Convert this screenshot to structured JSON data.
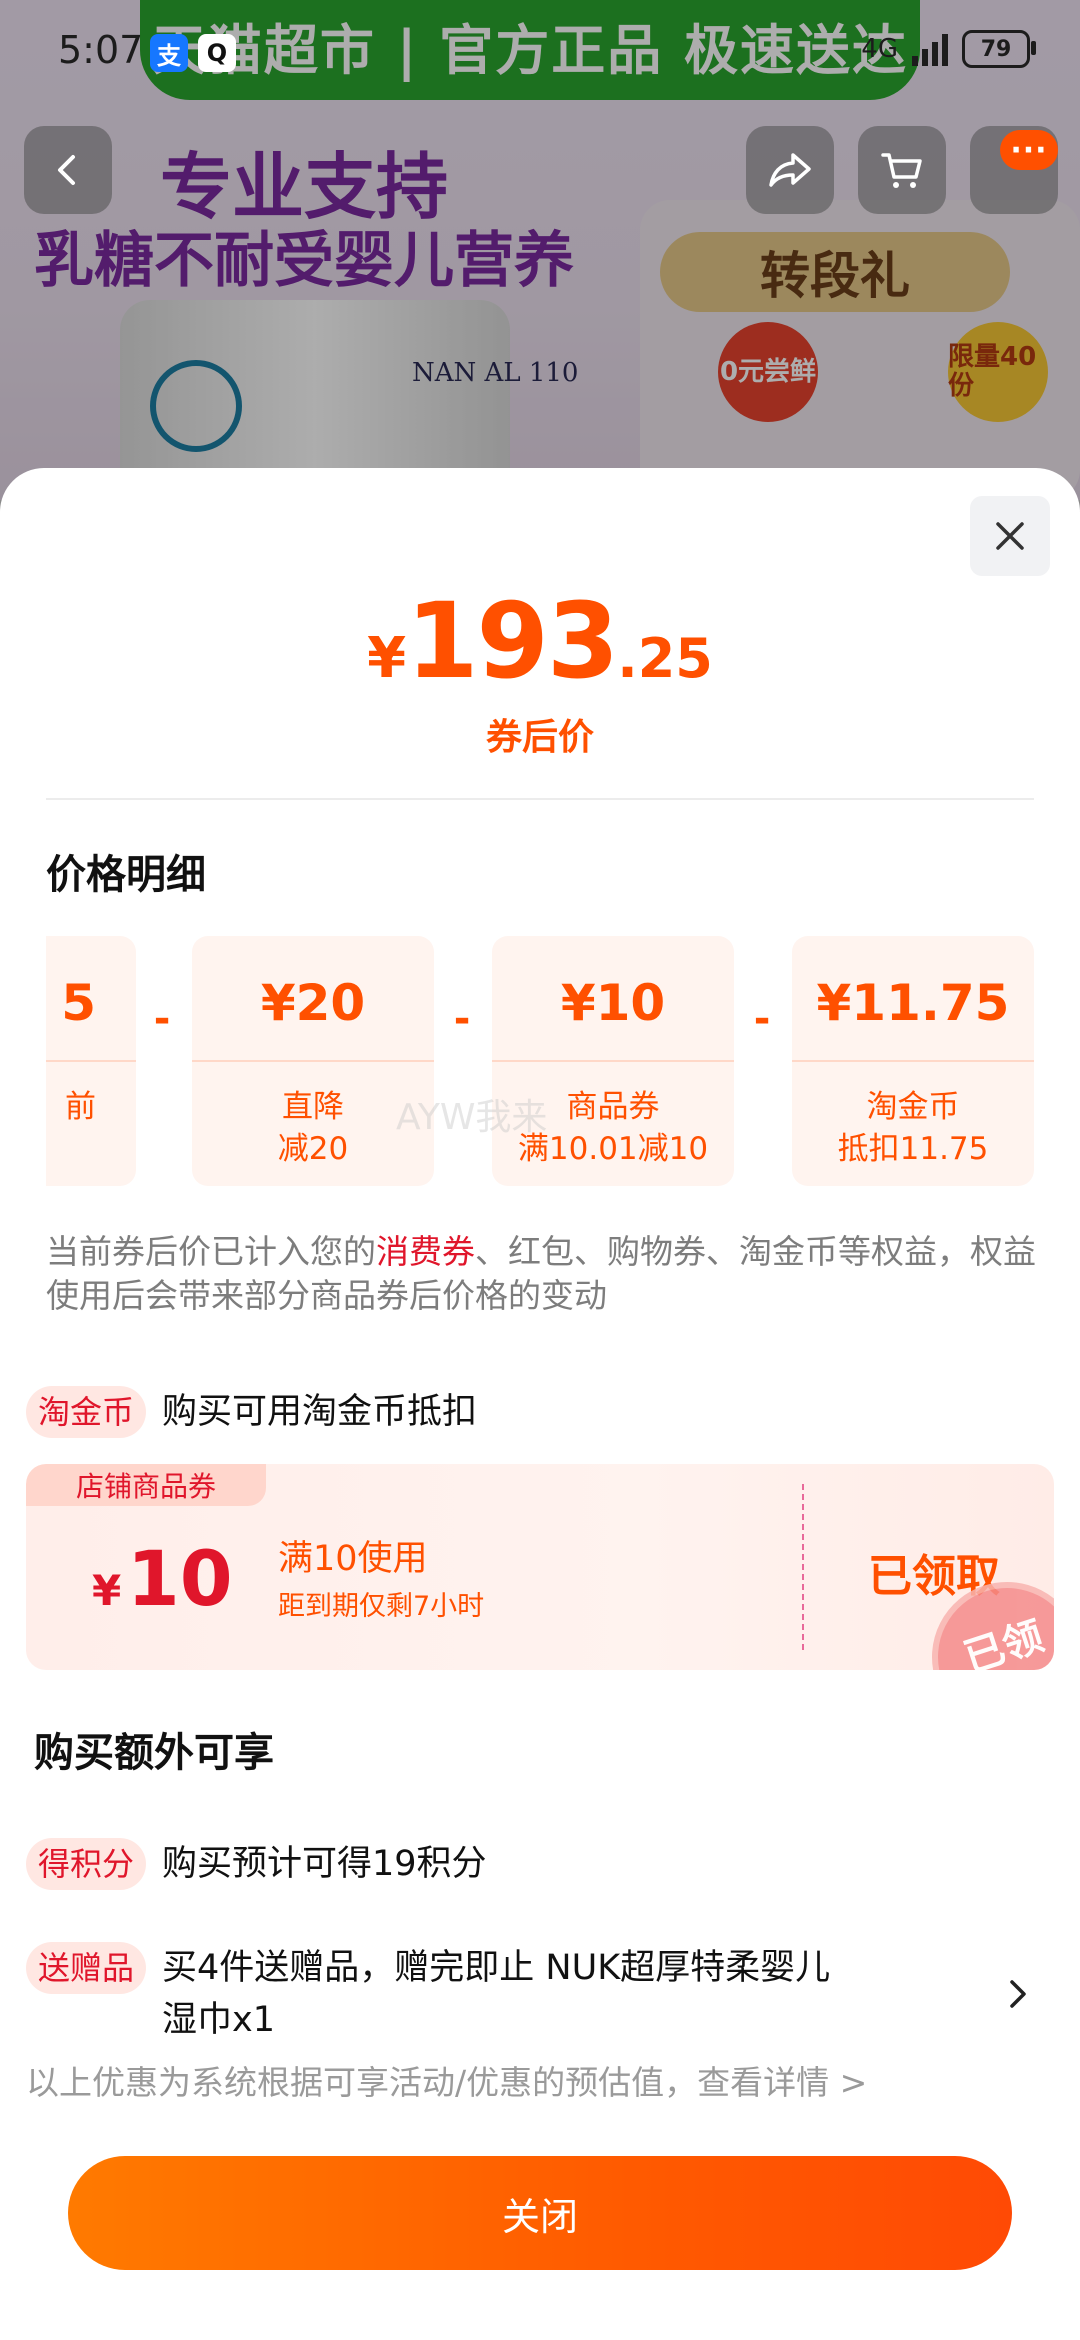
{
  "status_bar": {
    "time": "5:07",
    "battery": "79",
    "network": "4G"
  },
  "background": {
    "banner_text": "天猫超市 | 官方正品 极速送达",
    "headline_line1": "专业支持",
    "headline_line2": "乳糖不耐受婴儿营养",
    "can_label": "NAN AL 110",
    "gift_title": "转段礼",
    "badge_zero": "0元尝鲜",
    "badge_limit": "限量40份"
  },
  "price": {
    "currency": "¥",
    "integer": "193",
    "decimal": ".25",
    "label": "券后价"
  },
  "breakdown": {
    "title": "价格明细",
    "cards": [
      {
        "amount": "5",
        "label": "前",
        "sub": ""
      },
      {
        "amount": "¥20",
        "label": "直降",
        "sub": "减20"
      },
      {
        "amount": "¥10",
        "label": "商品券",
        "sub": "满10.01减10"
      },
      {
        "amount": "¥11.75",
        "label": "淘金币",
        "sub": "抵扣11.75"
      }
    ],
    "minus": "-"
  },
  "notice": {
    "before": "当前券后价已计入您的",
    "highlight": "消费券",
    "after": "、红包、购物券、淘金币等权益，权益使用后会带来部分商品券后价格的变动"
  },
  "taojinbi": {
    "tag": "淘金币",
    "text": "购买可用淘金币抵扣"
  },
  "coupon": {
    "type_tag": "店铺商品券",
    "currency": "¥",
    "value": "10",
    "condition": "满10使用",
    "expire": "距到期仅剩7小时",
    "status": "已领取",
    "stamp": "已领"
  },
  "extra": {
    "title": "购买额外可享",
    "points_tag": "得积分",
    "points_text": "购买预计可得19积分",
    "gift_tag": "送赠品",
    "gift_text_line1": "买4件送赠品，赠完即止 NUK超厚特柔婴儿",
    "gift_text_line2": "湿巾x1"
  },
  "footer_note": "以上优惠为系统根据可享活动/优惠的预估值，查看详情 >",
  "close_button": "关闭",
  "watermark": "AYW我来"
}
